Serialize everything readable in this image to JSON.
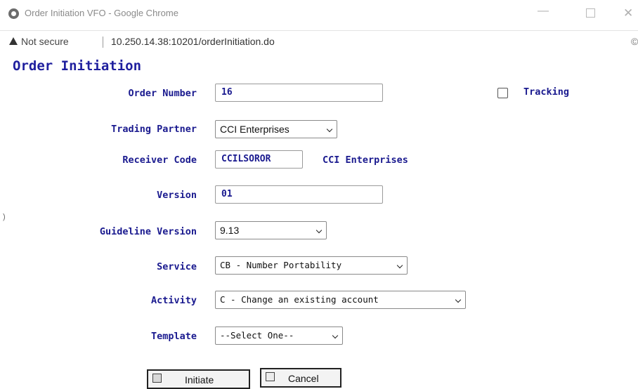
{
  "window": {
    "title": "Order Initiation VFO - Google Chrome",
    "minimize_glyph": "—",
    "close_glyph": "✕"
  },
  "urlbar": {
    "security_label": "Not secure",
    "url": "10.250.14.38:10201/orderInitiation.do",
    "right_glyph": "©"
  },
  "page": {
    "title": "Order Initiation",
    "margin_mark": ")"
  },
  "form": {
    "order_number": {
      "label": "Order Number",
      "value": "16"
    },
    "tracking": {
      "label": "Tracking",
      "checked": false
    },
    "trading_partner": {
      "label": "Trading Partner",
      "selected": "CCI Enterprises"
    },
    "receiver_code": {
      "label": "Receiver Code",
      "value": "CCILSOROR",
      "name": "CCI Enterprises"
    },
    "version": {
      "label": "Version",
      "value": "01"
    },
    "guideline_version": {
      "label": "Guideline Version",
      "selected": "9.13"
    },
    "service": {
      "label": "Service",
      "selected": "CB - Number Portability"
    },
    "activity": {
      "label": "Activity",
      "selected": "C - Change an existing account"
    },
    "template": {
      "label": "Template",
      "selected": "--Select One--"
    }
  },
  "buttons": {
    "initiate": "Initiate",
    "cancel": "Cancel"
  },
  "colors": {
    "label_text": "#1a1a8f",
    "title_text": "#1f1f9e"
  }
}
